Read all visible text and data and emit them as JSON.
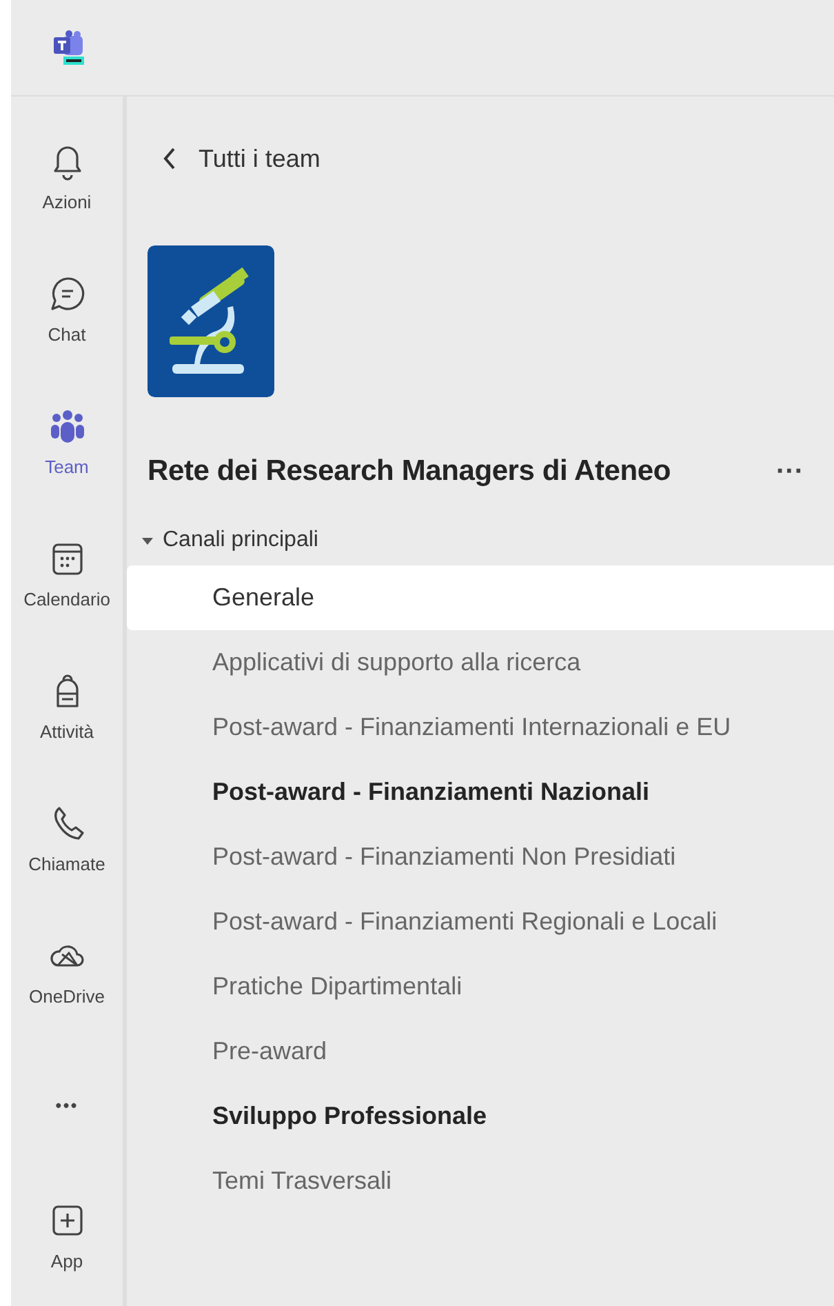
{
  "rail": [
    {
      "kind": "bell",
      "label": "Azioni",
      "selected": false
    },
    {
      "kind": "chat",
      "label": "Chat",
      "selected": false
    },
    {
      "kind": "team",
      "label": "Team",
      "selected": true
    },
    {
      "kind": "calendar",
      "label": "Calendario",
      "selected": false
    },
    {
      "kind": "backpack",
      "label": "Attività",
      "selected": false
    },
    {
      "kind": "phone",
      "label": "Chiamate",
      "selected": false
    },
    {
      "kind": "cloud",
      "label": "OneDrive",
      "selected": false
    },
    {
      "kind": "more",
      "label": "•••",
      "selected": false
    },
    {
      "kind": "add",
      "label": "App",
      "selected": false
    }
  ],
  "back_link": "Tutti i team",
  "team": {
    "name": "Rete dei Research Managers di Ateneo",
    "more": "···"
  },
  "section": {
    "label": "Canali principali",
    "expanded": true
  },
  "channels": [
    {
      "name": "Generale",
      "selected": true,
      "unread": false
    },
    {
      "name": "Applicativi di supporto alla ricerca",
      "selected": false,
      "unread": false
    },
    {
      "name": "Post-award - Finanziamenti Internazionali e EU",
      "selected": false,
      "unread": false
    },
    {
      "name": "Post-award - Finanziamenti Nazionali",
      "selected": false,
      "unread": true
    },
    {
      "name": "Post-award - Finanziamenti Non Presidiati",
      "selected": false,
      "unread": false
    },
    {
      "name": "Post-award - Finanziamenti Regionali e Locali",
      "selected": false,
      "unread": false
    },
    {
      "name": "Pratiche Dipartimentali",
      "selected": false,
      "unread": false
    },
    {
      "name": "Pre-award",
      "selected": false,
      "unread": false
    },
    {
      "name": "Sviluppo Professionale",
      "selected": false,
      "unread": true
    },
    {
      "name": "Temi Trasversali",
      "selected": false,
      "unread": false
    }
  ]
}
